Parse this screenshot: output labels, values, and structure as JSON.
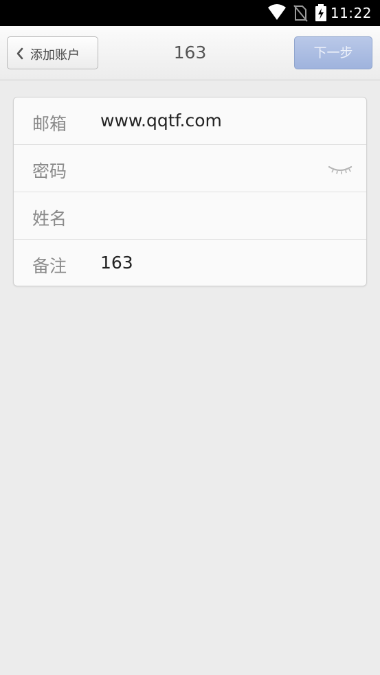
{
  "status_bar": {
    "time": "11:22",
    "icons": [
      "wifi-icon",
      "no-sim-icon",
      "battery-charging-icon"
    ]
  },
  "navbar": {
    "back_label": "添加账户",
    "title": "163",
    "next_label": "下一步",
    "next_color": "#a8b9e0"
  },
  "form": {
    "email": {
      "label": "邮箱",
      "value": "www.qqtf.com"
    },
    "password": {
      "label": "密码",
      "value": "",
      "toggle_icon": "eye-closed-icon"
    },
    "name": {
      "label": "姓名",
      "value": ""
    },
    "note": {
      "label": "备注",
      "value": "163"
    }
  }
}
